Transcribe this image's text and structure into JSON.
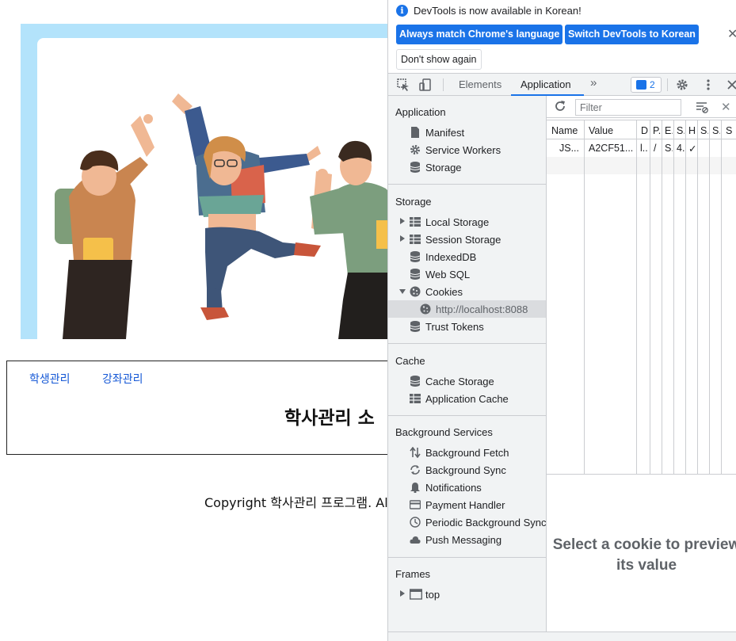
{
  "webpage": {
    "nav": {
      "student_mgmt": "학생관리",
      "course_mgmt": "강좌관리"
    },
    "heading": "학사관리 소",
    "copyright": "Copyright 학사관리 프로그램. Al"
  },
  "devtools": {
    "infobar": {
      "message": "DevTools is now available in Korean!",
      "always_match_label": "Always match Chrome's language",
      "switch_label": "Switch DevTools to Korean",
      "dont_show_label": "Don't show again"
    },
    "tabs": {
      "elements": "Elements",
      "application": "Application",
      "more": "»",
      "issues_count": "2"
    },
    "sidebar": {
      "application_title": "Application",
      "application_items": [
        "Manifest",
        "Service Workers",
        "Storage"
      ],
      "storage_title": "Storage",
      "storage_items": [
        "Local Storage",
        "Session Storage",
        "IndexedDB",
        "Web SQL",
        "Cookies"
      ],
      "cookie_origin": "http://localhost:8088",
      "trust_tokens": "Trust Tokens",
      "cache_title": "Cache",
      "cache_items": [
        "Cache Storage",
        "Application Cache"
      ],
      "bg_title": "Background Services",
      "bg_items": [
        "Background Fetch",
        "Background Sync",
        "Notifications",
        "Payment Handler",
        "Periodic Background Sync",
        "Push Messaging"
      ],
      "frames_title": "Frames",
      "frames_items": [
        "top"
      ]
    },
    "cookies": {
      "filter_placeholder": "Filter",
      "columns": [
        "Name",
        "Value",
        "D",
        "P.",
        "E.",
        "S.",
        "H",
        "S.",
        "S.",
        "S"
      ],
      "rows": [
        [
          "JS...",
          "A2CF51...",
          "l..",
          "/",
          "S.",
          "4.",
          "✓",
          "",
          "",
          ""
        ]
      ],
      "preview_message": "Select a cookie to preview its value"
    }
  }
}
